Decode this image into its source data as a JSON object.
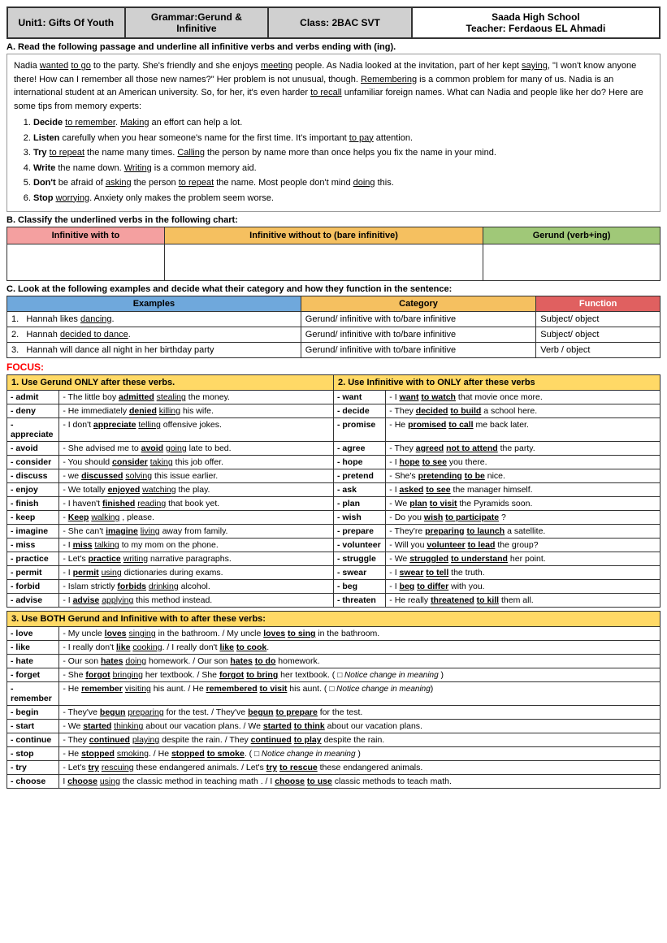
{
  "header": {
    "unit": "Unit1: Gifts Of Youth",
    "grammar": "Grammar:Gerund & Infinitive",
    "class": "Class: 2BAC SVT",
    "school": "Saada High School",
    "teacher": "Teacher: Ferdaous EL Ahmadi"
  },
  "section_a_label": "A.   Read the following passage and underline all infinitive verbs and verbs ending with (ing).",
  "passage": {
    "text1": "Nadia wanted to go to the party. She’s friendly and she enjoys meeting people. As Nadia looked at the invitation, part of her kept saying, “I won’t know anyone there! How can I remember all those new names?” Her problem is not unusual, though. Remembering is a common problem for many of us. Nadia is an international student at an American university. So, for her, it’s even harder to recall unfamiliar foreign names. What can Nadia and people like her do? Here are some tips from memory experts:",
    "tips": [
      "Decide to remember. Making an effort can help a lot.",
      "Listen carefully when you hear someone’s name for the first time. It’s important to pay attention.",
      "Try to repeat the name many times. Calling the person by name more than once helps you fix the name in your mind.",
      "Write the name down. Writing is a common memory aid.",
      "Don’t be afraid of asking the person to repeat the name. Most people don’t mind doing this.",
      "Stop worrying. Anxiety only makes the problem seem worse."
    ]
  },
  "section_b_label": "B.   Classify the underlined verbs in the following chart:",
  "chart_headers": {
    "col1": "Infinitive with to",
    "col2": "Infinitive without to (bare infinitive)",
    "col3": "Gerund (verb+ing)"
  },
  "section_c_label": "C.   Look at the following examples and decide what their category and how they function in the sentence:",
  "examples_table": {
    "headers": [
      "Examples",
      "Category",
      "Function"
    ],
    "rows": [
      {
        "num": "1.",
        "example": "Hannah likes dancing.",
        "category": "Gerund/ infinitive with to/bare infinitive",
        "function": "Subject/ object"
      },
      {
        "num": "2.",
        "example": "Hannah decided to dance.",
        "category": "Gerund/ infinitive with to/bare infinitive",
        "function": "Subject/ object"
      },
      {
        "num": "3.",
        "example": "Hannah will dance all night in her birthday party",
        "category": "Gerund/ infinitive with to/bare infinitive",
        "function": "Verb / object"
      }
    ]
  },
  "focus_label": "FOCUS:",
  "gerund_section": {
    "title": "1.  Use Gerund ONLY after these verbs.",
    "verbs": [
      {
        "verb": "admit",
        "example": "- The little boy admitted stealing the money."
      },
      {
        "verb": "deny",
        "example": "- He immediately denied killing his wife."
      },
      {
        "verb": "appreciate",
        "example": "- I don’t appreciate telling offensive jokes."
      },
      {
        "verb": "avoid",
        "example": "- She advised me to avoid going late to bed."
      },
      {
        "verb": "consider",
        "example": "- You should consider taking this job offer."
      },
      {
        "verb": "discuss",
        "example": "- we discussed solving this issue  earlier."
      },
      {
        "verb": "enjoy",
        "example": "- We totally enjoyed watching the play."
      },
      {
        "verb": "finish",
        "example": "- I haven’t finished reading that book yet."
      },
      {
        "verb": "keep",
        "example": "- Keep walking , please."
      },
      {
        "verb": "imagine",
        "example": "- She can’t imagine living away from family."
      },
      {
        "verb": "miss",
        "example": "- I miss talking to my mom on the phone."
      },
      {
        "verb": "practice",
        "example": "- Let’s practice writing narrative paragraphs."
      },
      {
        "verb": "permit",
        "example": "- I permit using dictionaries during exams."
      },
      {
        "verb": "forbid",
        "example": "- Islam strictly forbids drinking alcohol."
      },
      {
        "verb": "advise",
        "example": "- I advise applying this method  instead."
      }
    ]
  },
  "infinitive_section": {
    "title": "2.  Use Infinitive with to ONLY after these verbs",
    "verbs": [
      {
        "verb": "want",
        "example": "- I want to watch that movie once more."
      },
      {
        "verb": "decide",
        "example": "- They decided to build a school here."
      },
      {
        "verb": "promise",
        "example": "- He promised to call me back later."
      },
      {
        "verb": "agree",
        "example": "- They agreed not to attend the party."
      },
      {
        "verb": "hope",
        "example": "- I hope to see you there."
      },
      {
        "verb": "pretend",
        "example": "- She’s pretending to be nice."
      },
      {
        "verb": "ask",
        "example": "- I asked to see the manager himself."
      },
      {
        "verb": "plan",
        "example": "- We plan to visit the Pyramids soon."
      },
      {
        "verb": "wish",
        "example": "- Do you wish to participate ?"
      },
      {
        "verb": "prepare",
        "example": "- They’re preparing to launch a satellite."
      },
      {
        "verb": "volunteer",
        "example": "- Will you volunteer to lead the group?"
      },
      {
        "verb": "struggle",
        "example": "- We struggled to understand her point."
      },
      {
        "verb": "swear",
        "example": "- I swear to tell the truth."
      },
      {
        "verb": "beg",
        "example": "- I beg to differ with you."
      },
      {
        "verb": "threaten",
        "example": "- He really threatened to kill them all."
      }
    ]
  },
  "both_section": {
    "title": "3.  Use BOTH Gerund and Infinitive with to after these verbs:",
    "rows": [
      {
        "verb": "love",
        "example": "- My uncle loves singing in the bathroom. / My uncle loves to sing in the bathroom."
      },
      {
        "verb": "like",
        "example": "- I really don’t like cooking. / I really don’t like to cook."
      },
      {
        "verb": "hate",
        "example": "- Our son hates doing homework. / Our son hates to do homework."
      },
      {
        "verb": "forget",
        "example": "- She forgot bringing her textbook. / She forgot to bring her textbook. (  Notice change in meaning  )"
      },
      {
        "verb": "remember",
        "example": "- He remember visiting his aunt. / He remembered to visit his aunt. (  Notice change in meaning)"
      },
      {
        "verb": "begin",
        "example": "- They’ve begun preparing for the test. / They’ve begun to prepare for the test."
      },
      {
        "verb": "start",
        "example": "- We started thinking about our vacation plans. / We started to think about our vacation plans."
      },
      {
        "verb": "continue",
        "example": "- They continued playing despite the rain. / They continued to play despite the rain."
      },
      {
        "verb": "stop",
        "example": "- He stopped smoking. / He stopped to smoke. (  Notice change in meaning  )"
      },
      {
        "verb": "try",
        "example": "- Let’s try rescuing these endangered animals. / Let’s try to rescue these endangered animals."
      },
      {
        "verb": "choose",
        "example": "I choose using the classic method in teaching math . / I choose to use classic methods to teach math."
      }
    ]
  }
}
